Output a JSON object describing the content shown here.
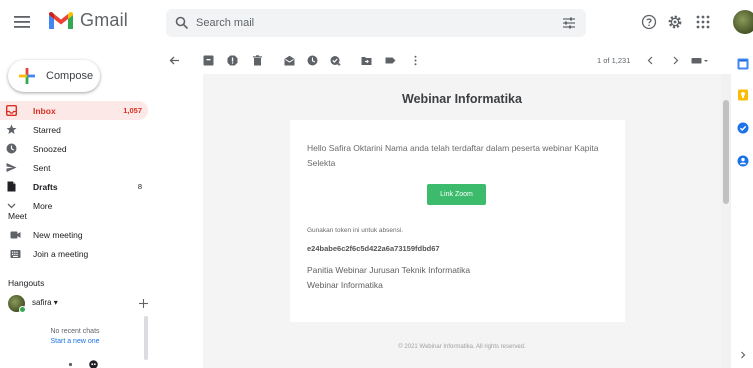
{
  "app": {
    "name": "Gmail"
  },
  "search": {
    "placeholder": "Search mail"
  },
  "compose": {
    "label": "Compose"
  },
  "nav": [
    {
      "label": "Inbox",
      "count": "1,057",
      "icon": "inbox-icon"
    },
    {
      "label": "Starred",
      "count": "",
      "icon": "star-icon"
    },
    {
      "label": "Snoozed",
      "count": "",
      "icon": "clock-icon"
    },
    {
      "label": "Sent",
      "count": "",
      "icon": "send-icon"
    },
    {
      "label": "Drafts",
      "count": "8",
      "icon": "draft-icon"
    },
    {
      "label": "More",
      "count": "",
      "icon": "chevron-down-icon"
    }
  ],
  "meet": {
    "title": "Meet",
    "new_meeting": "New meeting",
    "join_meeting": "Join a meeting"
  },
  "hangouts": {
    "title": "Hangouts",
    "user": "safira",
    "no_chats": "No recent chats",
    "start_new": "Start a new one"
  },
  "toolbar": {
    "page_count": "1 of 1,231"
  },
  "email": {
    "title": "Webinar Informatika",
    "greeting": "Hello Safira Oktarini Nama anda telah terdaftar dalam peserta webinar Kapita Selekta",
    "button_label": "Link Zoom",
    "token_note": "Gunakan token ini untuk absensi.",
    "token": "e24babe6c2f6c5d422a6a73159fdbd67",
    "signature_line1": "Panitia Webinar Jurusan Teknik Informatika",
    "signature_line2": "Webinar Informatika",
    "copyright": "© 2021 Webinar Informatika. All rights reserved."
  },
  "colors": {
    "gmail_red": "#ea4335",
    "inbox_active_bg": "#fce8e6",
    "inbox_active_text": "#d93025",
    "button_green": "#3dbb6c",
    "link_blue": "#1a73e8"
  }
}
